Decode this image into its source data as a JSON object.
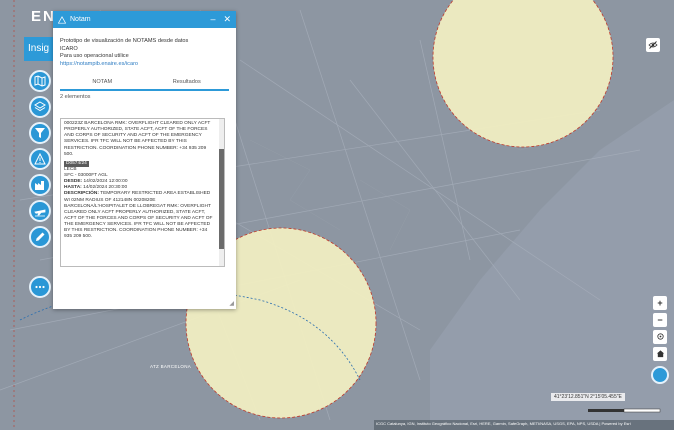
{
  "app": {
    "logo": "EN",
    "insig_button": "Insig"
  },
  "dialog": {
    "title": "Notam",
    "minimize": "–",
    "close": "✕",
    "intro_line1": "Prototipo de visualización de NOTAMS desde datos",
    "intro_line2": "ICARO",
    "intro_line3": "Para uso operacional utilice",
    "intro_link": "https://notampib.enaire.es/icaro",
    "tabs": [
      "NOTAM",
      "Resultados"
    ],
    "count_label": "2 elementos"
  },
  "results": {
    "prev_text": "000223Z BARCELONA RMK: OVERFLIGHT CLEARED ONLY ACFT PROPERLY AUTHORIZED, STATE ACFT, ACFT OF THE FORCES AND CORPS OF SECURITY AND ACFT OF THE EMERGENCY SERVICES. IFR TFC WILL NOT BE AFFECTED BY THIS RESTRICTION. COORDINATION PHONE NUMBER: +34 935 209 500.",
    "notam_id": "D0574/24",
    "location": "LECB",
    "limits": "SFC - 03000FT AGL",
    "desde_label": "DESDE:",
    "desde_value": "14/02/2024 12:00:00",
    "hasta_label": "HASTA:",
    "hasta_value": "14/02/2024 20:30:00",
    "desc_label": "DESCRIPCIÓN:",
    "desc_value": "TEMPORARY RESTRICTED AREA ESTABLISHED WI 02NM RADIUS OF 412148N 0020820E BARCELONA/L'HOSPITALET DE LLOBREGAT RMK: OVERFLIGHT CLEARED ONLY ACFT PROPERLY AUTHORIZED, STATE ACFT, ACFT OF THE FORCES AND CORPS OF SECURITY AND ACFT OF THE EMERGENCY SERVICES. IFR TFC WILL NOT BE AFFECTED BY THIS RESTRICTION. COORDINATION PHONE NUMBER: +34 935 209 500."
  },
  "sidebar_icons": [
    "map-icon",
    "layers-icon",
    "filter-icon",
    "warning-icon",
    "factory-icon",
    "airplane-icon",
    "pencil-icon",
    "more-icon"
  ],
  "map": {
    "place_label": "ATZ BARCELONA",
    "coordinates": "41°23'12.851\"N 2°15'05.455\"E",
    "attribution": "ICGC Catalunya, IGN, Instituto Geográfico Nacional, Esri, HERE, Garmin, SafeGraph, METI/NASA, USGS, EPA, NPS, USDA | Powered by Esri",
    "zoom_in": "+",
    "zoom_out": "−",
    "accent": "#2d9ad8",
    "zone_fill": "#f3f0c2",
    "zone_stroke": "#c0392b"
  }
}
